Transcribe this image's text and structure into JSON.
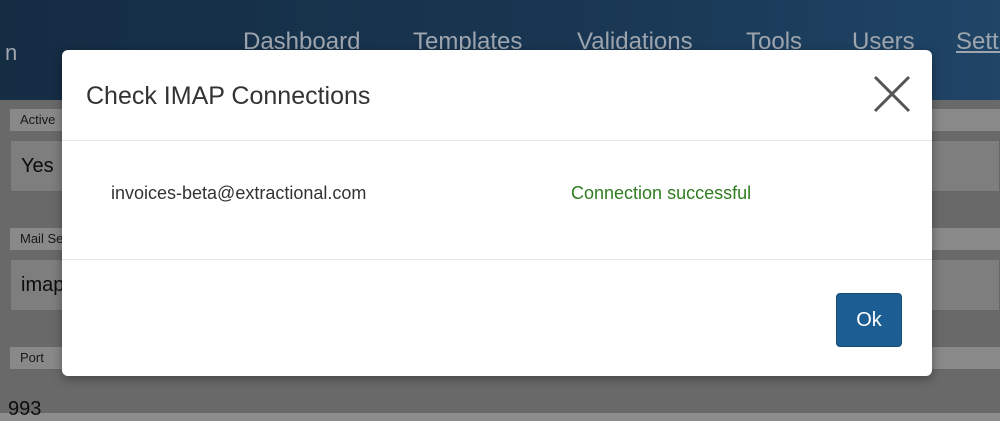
{
  "app": {
    "brand_fragment": "n",
    "nav": [
      "Dashboard",
      "Templates",
      "Validations",
      "Tools",
      "Users",
      "Settings"
    ],
    "active_nav": "Settings"
  },
  "form": {
    "active_label": "Active",
    "active_value": "Yes",
    "mail_label": "Mail Server",
    "mail_value": "imap",
    "port_label": "Port",
    "port_value": "993"
  },
  "modal": {
    "title": "Check IMAP Connections",
    "rows": [
      {
        "account": "invoices-beta@extractional.com",
        "status": "Connection successful",
        "status_color": "#2e7d1f"
      }
    ],
    "ok_label": "Ok",
    "close_icon": "close-icon"
  }
}
